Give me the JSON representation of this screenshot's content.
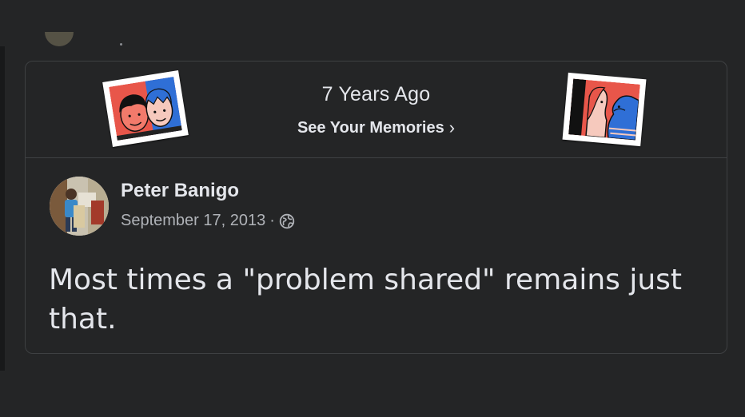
{
  "memory": {
    "years_ago": "7 Years Ago",
    "see_memories": "See Your Memories",
    "chevron": "›"
  },
  "post": {
    "author": "Peter Banigo",
    "date": "September 17, 2013",
    "separator": "·",
    "privacy_icon": "globe-icon",
    "text": "Most times a \"problem shared\" remains just that."
  },
  "colors": {
    "background": "#242526",
    "card_border": "#3e4042",
    "primary_text": "#e4e6eb",
    "secondary_text": "#b0b3b8",
    "memory_red": "#e8564a",
    "memory_blue": "#2f6fd6"
  },
  "icons": {
    "left_illustration": "friends-photo-icon",
    "right_illustration": "couple-photo-icon",
    "avatar": "profile-photo"
  }
}
